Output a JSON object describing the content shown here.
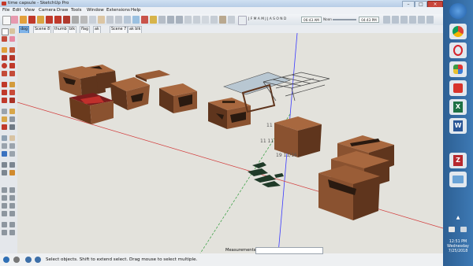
{
  "window": {
    "title": "time capsule - SketchUp Pro"
  },
  "menu": [
    "File",
    "Edit",
    "View",
    "Camera",
    "Draw",
    "Tools",
    "Window",
    "Extensions",
    "Help"
  ],
  "timebar": {
    "months": "J F M A M J J A S O N D",
    "start_time": "06:43 AM",
    "noon": "Noon",
    "end_time": "04:43 PM"
  },
  "scenes": [
    "dog",
    "Scene 8",
    "thumb",
    "blk",
    "flag",
    "ak",
    "Scene 7",
    "ak blk"
  ],
  "active_scene": "dog",
  "viewport": {
    "dim_labels": [
      "11",
      "11 11",
      "19 11/16"
    ]
  },
  "status": {
    "text": "Select objects. Shift to extend select. Drag mouse to select multiple.",
    "measurements_label": "Measurements",
    "measurements_value": ""
  },
  "taskbar": {
    "icons": [
      {
        "name": "windows-start-icon",
        "color": "#2f6fb5"
      },
      {
        "name": "chrome-icon",
        "color": "#e2e8ee"
      },
      {
        "name": "opera-icon",
        "color": "#e2e8ee"
      },
      {
        "name": "paint-icon",
        "color": "#e2e8ee"
      },
      {
        "name": "sketchup-icon",
        "color": "#e2e8ee"
      },
      {
        "name": "excel-icon",
        "color": "#1e7145"
      },
      {
        "name": "word-icon",
        "color": "#2b5797"
      },
      {
        "name": "filezilla-icon",
        "color": "#b7282e"
      },
      {
        "name": "windows-explorer-icon",
        "color": "#6aa3d6"
      }
    ],
    "time": "12:51 PM",
    "day": "Wednesday",
    "date": "7/25/2018"
  },
  "colors": {
    "box_front": "#8a5230",
    "box_side": "#5f351d",
    "box_top": "#a8683f",
    "axis_blue": "#3a3aff",
    "axis_red": "#d23c3c",
    "axis_green": "#2f9b3a"
  }
}
